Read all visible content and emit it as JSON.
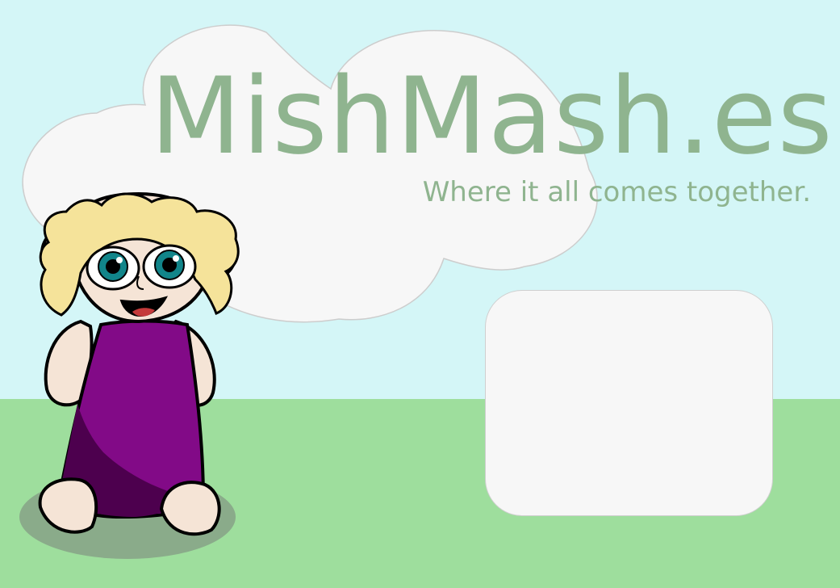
{
  "site": {
    "title": "MishMash.es!",
    "tagline": "Where it all comes together."
  },
  "colors": {
    "sky": "#d4f6f7",
    "grass": "#9ede9d",
    "cloud": "#f7f7f7",
    "title_text": "#8fb48f",
    "dress": "#820a87",
    "dress_shadow": "#4d004e",
    "hair": "#f5e39a",
    "skin": "#f5e4d6",
    "eyes": "#11858a"
  },
  "illustration": {
    "character": "cartoon-girl-purple-dress",
    "background": "clouds-sky-grass"
  }
}
